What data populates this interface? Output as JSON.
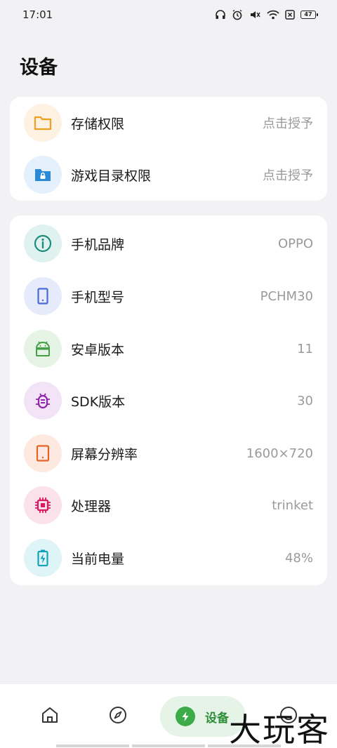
{
  "status_bar": {
    "time": "17:01",
    "battery": "47",
    "icons": [
      "headphones-icon",
      "alarm-icon",
      "mute-icon",
      "wifi-icon",
      "sim-off-icon",
      "battery-icon"
    ]
  },
  "page": {
    "title": "设备"
  },
  "permissions": [
    {
      "label": "存储权限",
      "value": "点击授予",
      "icon": "folder-icon",
      "color": "#f0a020",
      "bg": "#fdf1e1"
    },
    {
      "label": "游戏目录权限",
      "value": "点击授予",
      "icon": "folder-lock-icon",
      "color": "#2b8ad8",
      "bg": "#e4f0fb"
    }
  ],
  "device_info": [
    {
      "label": "手机品牌",
      "value": "OPPO",
      "icon": "info-icon",
      "color": "#1b8c7c",
      "bg": "#e0f2ef"
    },
    {
      "label": "手机型号",
      "value": "PCHM30",
      "icon": "phone-icon",
      "color": "#4a6bd6",
      "bg": "#e6ebfb"
    },
    {
      "label": "安卓版本",
      "value": "11",
      "icon": "android-icon",
      "color": "#43a047",
      "bg": "#e6f4e6"
    },
    {
      "label": "SDK版本",
      "value": "30",
      "icon": "bug-icon",
      "color": "#8e24aa",
      "bg": "#f2e3f6"
    },
    {
      "label": "屏幕分辨率",
      "value": "1600×720",
      "icon": "tablet-icon",
      "color": "#e8622c",
      "bg": "#fde9e0"
    },
    {
      "label": "处理器",
      "value": "trinket",
      "icon": "chip-icon",
      "color": "#d81b60",
      "bg": "#fbe2ea"
    },
    {
      "label": "当前电量",
      "value": "48%",
      "icon": "battery-charging-icon",
      "color": "#12a3b8",
      "bg": "#dff4f7"
    }
  ],
  "bottom_nav": {
    "items": [
      {
        "name": "home",
        "icon": "home-icon"
      },
      {
        "name": "discover",
        "icon": "compass-icon"
      },
      {
        "name": "device",
        "icon": "bolt-icon",
        "label": "设备",
        "active": true
      },
      {
        "name": "profile",
        "icon": "profile-icon"
      }
    ]
  },
  "watermark": "大玩客"
}
